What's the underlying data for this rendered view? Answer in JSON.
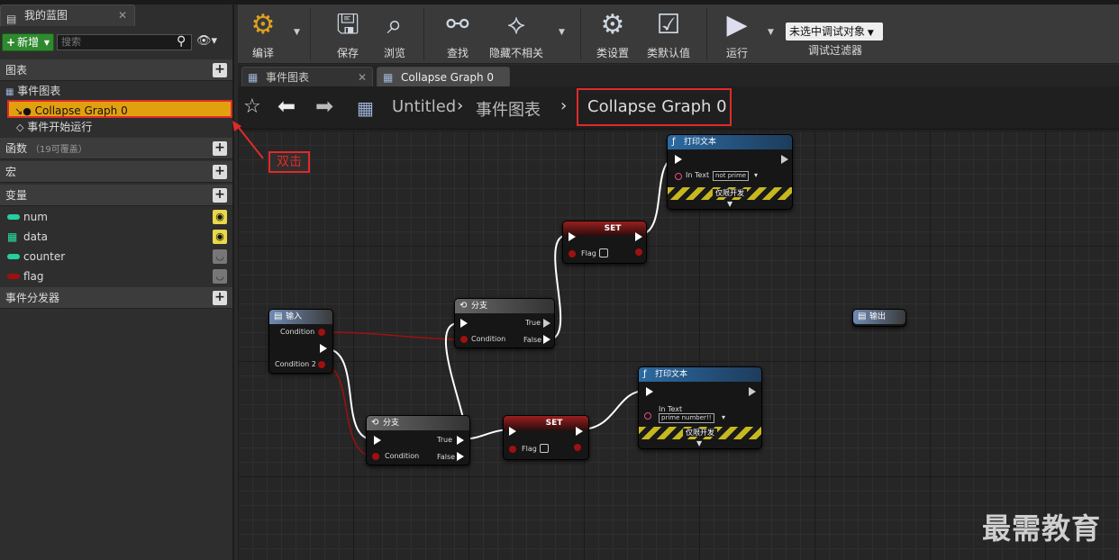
{
  "left_panel": {
    "tab_title": "我的蓝图",
    "add_label": "新增",
    "search_placeholder": "搜索",
    "sections": {
      "graphs": "图表",
      "functions": "函数",
      "functions_sub": "（19可覆盖）",
      "macros": "宏",
      "variables": "变量",
      "dispatchers": "事件分发器"
    },
    "tree": {
      "event_graph": "事件图表",
      "collapse_graph": "Collapse Graph 0",
      "begin_play": "事件开始运行"
    },
    "variables": [
      {
        "name": "num",
        "color": "#25d0a0",
        "kind": "pill"
      },
      {
        "name": "data",
        "color": "#25e0a0",
        "kind": "grid"
      },
      {
        "name": "counter",
        "color": "#25d0a0",
        "kind": "pill"
      },
      {
        "name": "flag",
        "color": "#a01010",
        "kind": "pill"
      }
    ]
  },
  "toolbar": {
    "compile": "编译",
    "save": "保存",
    "browse": "浏览",
    "find": "查找",
    "hide_unrelated": "隐藏不相关",
    "class_settings": "类设置",
    "class_defaults": "类默认值",
    "play": "运行",
    "debug_select": "未选中调试对象",
    "debug_filter": "调试过滤器"
  },
  "doc_tabs": [
    "事件图表",
    "Collapse Graph 0"
  ],
  "breadcrumb": {
    "root": "Untitled",
    "graph": "事件图表",
    "current": "Collapse Graph 0"
  },
  "annotation": "双击",
  "watermark": "最需教育",
  "nodes": {
    "print1": {
      "title": "打印文本",
      "in_text": "In Text",
      "value": "not prime",
      "dev_only": "仅限开发"
    },
    "print2": {
      "title": "打印文本",
      "in_text": "In Text",
      "value": "prime number!!",
      "dev_only": "仅限开发"
    },
    "set1": {
      "title": "SET",
      "flag": "Flag"
    },
    "set2": {
      "title": "SET",
      "flag": "Flag"
    },
    "branch1": {
      "title": "分支",
      "true": "True",
      "false": "False",
      "condition": "Condition"
    },
    "branch2": {
      "title": "分支",
      "true": "True",
      "false": "False",
      "condition": "Condition"
    },
    "input": {
      "title": "输入",
      "condition": "Condition",
      "condition2": "Condition 2"
    },
    "output": {
      "title": "输出"
    }
  }
}
